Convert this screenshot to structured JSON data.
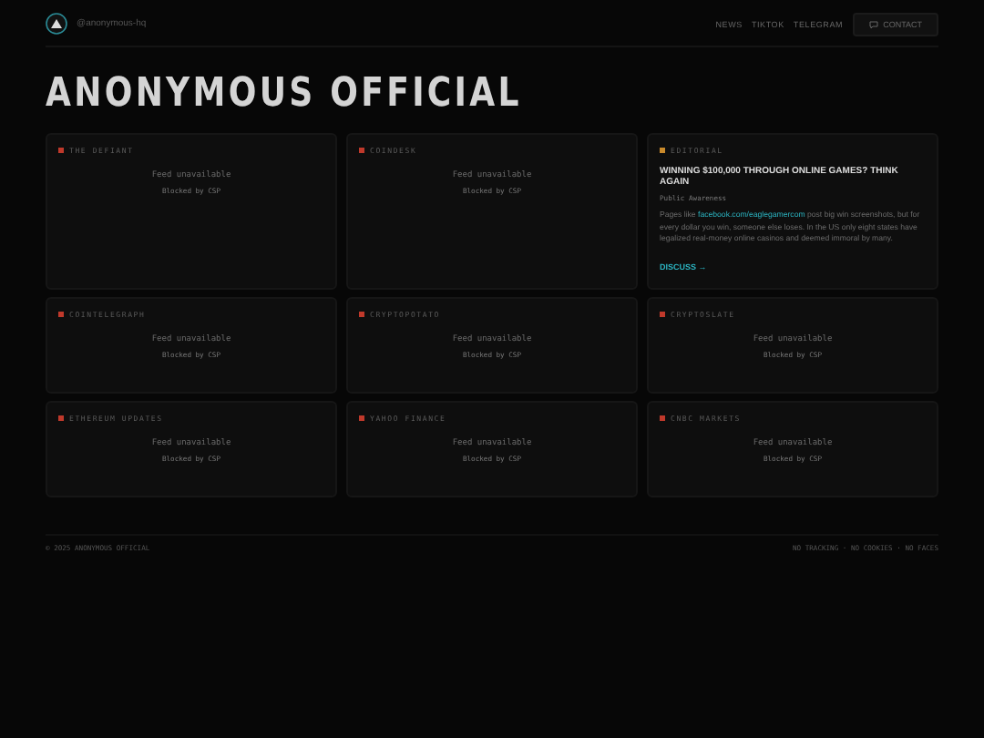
{
  "header": {
    "handle": "@anonymous-hq",
    "nav": [
      "NEWS",
      "TIKTOK",
      "TELEGRAM"
    ],
    "contact": "CONTACT"
  },
  "title": "ANONYMOUS OFFICIAL",
  "cards": [
    {
      "kind": "feed",
      "label": "THE DEFIANT",
      "color": "#c0392b",
      "status": "Feed unavailable",
      "note": "Blocked by CSP"
    },
    {
      "kind": "feed",
      "label": "COINDESK",
      "color": "#c0392b",
      "status": "Feed unavailable",
      "note": "Blocked by CSP"
    },
    {
      "kind": "article",
      "label": "EDITORIAL",
      "color": "#c98a2b",
      "headline": "WINNING $100,000 THROUGH ONLINE GAMES? THINK AGAIN",
      "tag": "Public Awareness",
      "body_before": "Pages like",
      "link": "facebook.com/eaglegamercom",
      "body_after": "post big win screenshots, but for every dollar you win, someone else loses. In the US only eight states have legalized real-money online casinos and deemed immoral by many.",
      "action": "DISCUSS →"
    },
    {
      "kind": "feed",
      "label": "COINTELEGRAPH",
      "color": "#c0392b",
      "status": "Feed unavailable",
      "note": "Blocked by CSP"
    },
    {
      "kind": "feed",
      "label": "CRYPTOPOTATO",
      "color": "#c0392b",
      "status": "Feed unavailable",
      "note": "Blocked by CSP"
    },
    {
      "kind": "feed",
      "label": "CRYPTOSLATE",
      "color": "#c0392b",
      "status": "Feed unavailable",
      "note": "Blocked by CSP"
    },
    {
      "kind": "feed",
      "label": "ETHEREUM UPDATES",
      "color": "#c0392b",
      "status": "Feed unavailable",
      "note": "Blocked by CSP"
    },
    {
      "kind": "feed",
      "label": "YAHOO FINANCE",
      "color": "#c0392b",
      "status": "Feed unavailable",
      "note": "Blocked by CSP"
    },
    {
      "kind": "feed",
      "label": "CNBC MARKETS",
      "color": "#c0392b",
      "status": "Feed unavailable",
      "note": "Blocked by CSP"
    }
  ],
  "footer": {
    "copyright": "© 2025 ANONYMOUS OFFICIAL",
    "notice": "NO TRACKING · NO COOKIES · NO FACES"
  }
}
